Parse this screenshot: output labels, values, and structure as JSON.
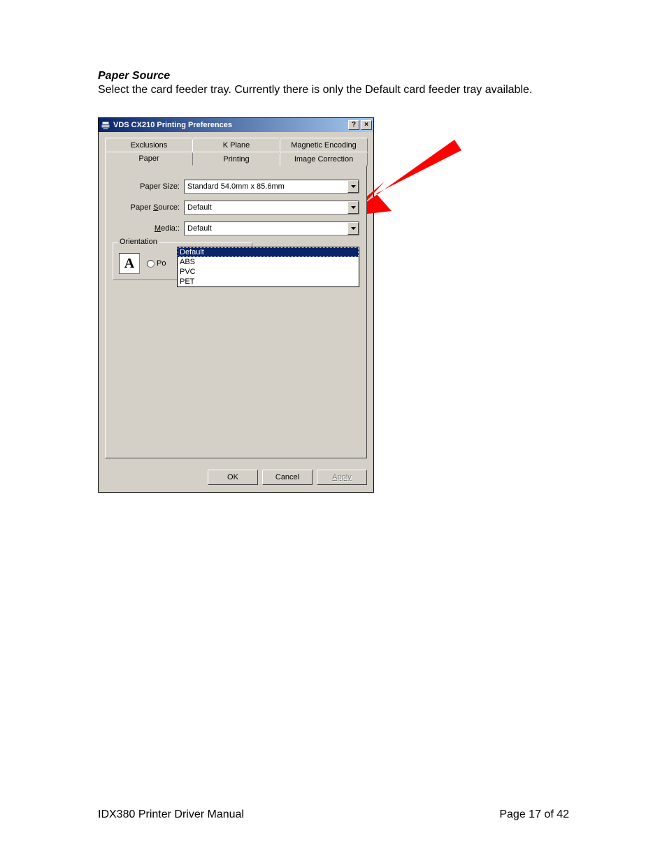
{
  "doc": {
    "heading": "Paper Source",
    "body": "Select the card feeder tray. Currently there is only the Default card feeder tray available.",
    "footer_left": "IDX380 Printer Driver Manual",
    "footer_right": "Page 17 of 42"
  },
  "dialog": {
    "title": "VDS CX210 Printing Preferences",
    "tabs_back": [
      "Exclusions",
      "K Plane",
      "Magnetic Encoding"
    ],
    "tabs_front": [
      "Paper",
      "Printing",
      "Image Correction"
    ],
    "labels": {
      "paper_size": "Paper Size:",
      "paper_source_pre": "Paper ",
      "paper_source_u": "S",
      "paper_source_post": "ource:",
      "media_u": "M",
      "media_post": "edia:",
      "orientation": "Orientation",
      "orient_radio_u": "P",
      "orient_radio_post": "o",
      "a_sample": "A"
    },
    "fields": {
      "paper_size": "Standard 54.0mm x 85.6mm",
      "paper_source": "Default",
      "media": "Default"
    },
    "media_options": [
      "Default",
      "ABS",
      "PVC",
      "PET"
    ],
    "buttons": {
      "ok": "OK",
      "cancel": "Cancel",
      "apply": "Apply"
    },
    "titlebar_help": "?",
    "titlebar_close": "×"
  }
}
